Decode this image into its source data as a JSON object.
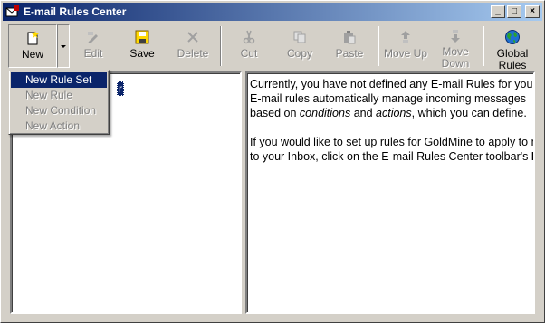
{
  "window": {
    "title": "E-mail Rules Center",
    "minimize_glyph": "_",
    "maximize_glyph": "□",
    "close_glyph": "×"
  },
  "toolbar": {
    "new": "New",
    "edit": "Edit",
    "save": "Save",
    "delete": "Delete",
    "cut": "Cut",
    "copy": "Copy",
    "paste": "Paste",
    "move_up": "Move Up",
    "move_down_line1": "Move",
    "move_down_line2": "Down",
    "global_line1": "Global",
    "global_line2": "Rules"
  },
  "menu": {
    "items": [
      {
        "label": "New Rule Set",
        "state": "selected"
      },
      {
        "label": "New Rule",
        "state": "disabled"
      },
      {
        "label": "New Condition",
        "state": "disabled"
      },
      {
        "label": "New Action",
        "state": "disabled"
      }
    ]
  },
  "tree": {
    "node_label": "r"
  },
  "info": {
    "line1": "Currently, you have not defined any E-mail Rules for yours",
    "line2": "E-mail rules automatically manage incoming messages",
    "line3_pre": "based on ",
    "line3_em1": "conditions",
    "line3_mid": " and ",
    "line3_em2": "actions",
    "line3_post": ", which you can define.",
    "line4": "If you would like to set up rules for GoldMine to apply to me",
    "line5_pre": "to your Inbox, click on the E-mail Rules Center toolbar's ",
    "line5_bold": "Ne"
  },
  "colors": {
    "title_active": "#0a246a",
    "face": "#d4d0c8",
    "selection": "#0a246a"
  },
  "icons": [
    "app-icon",
    "new-icon",
    "edit-icon",
    "save-icon",
    "delete-icon",
    "cut-icon",
    "copy-icon",
    "paste-icon",
    "move-up-icon",
    "move-down-icon",
    "globe-icon"
  ]
}
